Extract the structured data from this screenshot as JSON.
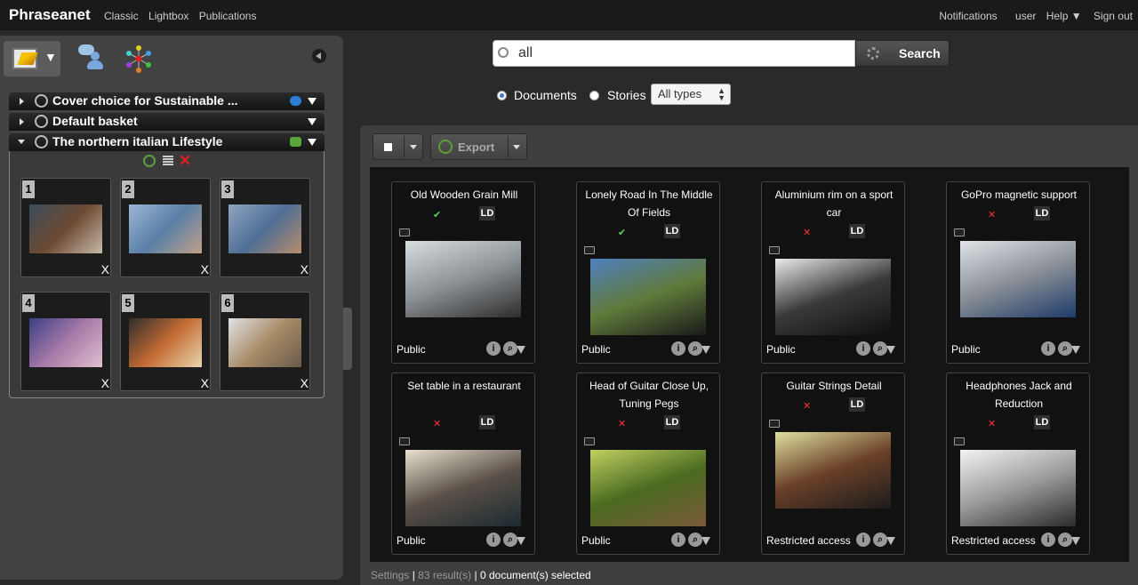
{
  "topbar": {
    "brand": "Phraseanet",
    "nav": [
      "Classic",
      "Lightbox",
      "Publications"
    ],
    "right": [
      "Notifications",
      "user",
      "Help ▼",
      "Sign out"
    ]
  },
  "left_panel": {
    "baskets": [
      {
        "title": "Cover choice for Sustainable ...",
        "icon": "chat-bubble-icon"
      },
      {
        "title": "Default basket"
      },
      {
        "title": "The northern italian Lifestyle",
        "icon": "bug-icon"
      }
    ],
    "basket_items": [
      {
        "num": "1",
        "remove": "X",
        "colors": [
          "#3a4c5a",
          "#6d4a33",
          "#c7b9a7"
        ]
      },
      {
        "num": "2",
        "remove": "X",
        "colors": [
          "#9cb6d4",
          "#5a7fa8",
          "#c0a088"
        ]
      },
      {
        "num": "3",
        "remove": "X",
        "colors": [
          "#8fa6c0",
          "#4f6d95",
          "#b98d6a"
        ]
      },
      {
        "num": "4",
        "remove": "X",
        "colors": [
          "#3a3f86",
          "#a87aa8",
          "#e0c0d0"
        ]
      },
      {
        "num": "5",
        "remove": "X",
        "colors": [
          "#2e2e2e",
          "#c46a33",
          "#e9d6b0"
        ]
      },
      {
        "num": "6",
        "remove": "X",
        "colors": [
          "#dfe2e4",
          "#a88c68",
          "#6a5a4a"
        ]
      }
    ]
  },
  "search": {
    "query": "all",
    "button_label": "Search",
    "radio_documents": "Documents",
    "radio_stories": "Stories",
    "types_selected": "All types"
  },
  "toolbar": {
    "export_label": "Export"
  },
  "results": [
    {
      "title": "Old Wooden Grain Mill",
      "status": "✔",
      "status_ok": true,
      "access": "Public",
      "colors": [
        "#d8dde0",
        "#8d9296",
        "#2c2c2c"
      ]
    },
    {
      "title": "Lonely Road In The Middle Of Fields",
      "status": "✔",
      "status_ok": true,
      "access": "Public",
      "colors": [
        "#4f80c0",
        "#5f7a3a",
        "#1a1a1a"
      ]
    },
    {
      "title": "Aluminium rim on a sport car",
      "status": "✕",
      "status_ok": false,
      "access": "Public",
      "colors": [
        "#eaeaea",
        "#3a3a3a",
        "#0f0f0f"
      ]
    },
    {
      "title": "GoPro magnetic support",
      "status": "✕",
      "status_ok": false,
      "access": "Public",
      "colors": [
        "#e0e4e8",
        "#8a8f96",
        "#1e3b6a"
      ]
    },
    {
      "title": "Set table in a restaurant",
      "status": "✕",
      "status_ok": false,
      "access": "Public",
      "colors": [
        "#e8e0d0",
        "#5a5048",
        "#1c2a30"
      ]
    },
    {
      "title": "Head of Guitar Close Up, Tuning Pegs",
      "status": "✕",
      "status_ok": false,
      "access": "Public",
      "colors": [
        "#c0d060",
        "#4a6a20",
        "#7a5a3a"
      ]
    },
    {
      "title": "Guitar Strings Detail",
      "status": "✕",
      "status_ok": false,
      "access": "Restricted access",
      "colors": [
        "#e0e0a0",
        "#6a4028",
        "#1c1c1c"
      ]
    },
    {
      "title": "Headphones Jack and Reduction",
      "status": "✕",
      "status_ok": false,
      "access": "Restricted access",
      "colors": [
        "#f4f4f4",
        "#9a9a9a",
        "#2a2a2a"
      ]
    }
  ],
  "footer": {
    "settings": "Settings",
    "sep": " | ",
    "results_count": "83 result(s)",
    "selected": "0 document(s) selected"
  }
}
